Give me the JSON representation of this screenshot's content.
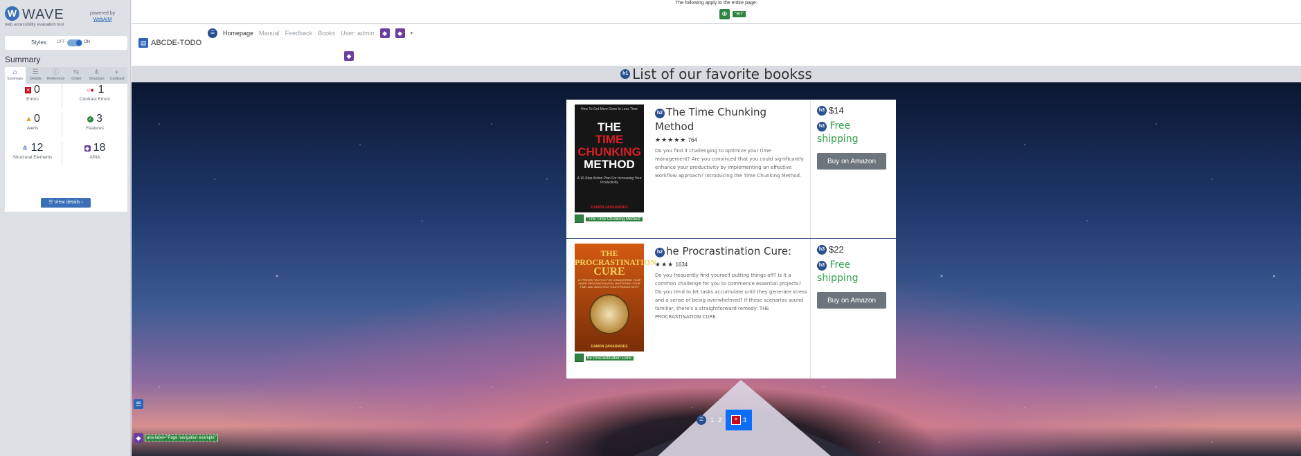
{
  "wave": {
    "logo_letter": "W",
    "title": "WAVE",
    "subtitle": "web accessibility evaluation tool",
    "powered_by": "powered by",
    "powered_link": "WebAIM",
    "styles_label": "Styles:",
    "styles_off": "OFF",
    "styles_on": "ON",
    "summary_heading": "Summary",
    "tabs": [
      {
        "label": "Summary",
        "icon": "home-icon",
        "glyph": "⌂"
      },
      {
        "label": "Details",
        "icon": "list-icon",
        "glyph": "☰"
      },
      {
        "label": "Reference",
        "icon": "info-icon",
        "glyph": "ⓘ"
      },
      {
        "label": "Order",
        "icon": "order-icon",
        "glyph": "⇆"
      },
      {
        "label": "Structure",
        "icon": "structure-icon",
        "glyph": "⋔"
      },
      {
        "label": "Contrast",
        "icon": "contrast-icon",
        "glyph": "◐"
      }
    ],
    "stats": {
      "errors": {
        "value": "0",
        "label": "Errors"
      },
      "contrast_errors": {
        "value": "1",
        "label": "Contrast Errors"
      },
      "alerts": {
        "value": "0",
        "label": "Alerts"
      },
      "features": {
        "value": "3",
        "label": "Features"
      },
      "structural": {
        "value": "12",
        "label": "Structural Elements"
      },
      "aria": {
        "value": "18",
        "label": "ARIA"
      }
    },
    "view_details": "View details ›"
  },
  "page": {
    "lang_note": "The following apply to the entire page:",
    "lang_value": "\"en\"",
    "brand": "ABCDE-TODO",
    "nav": {
      "homepage": "Homepage",
      "manual": "Manual",
      "feedback": "Feedback",
      "books": "Books",
      "user": "User: admin"
    },
    "heading": "List of our favorite bookss",
    "heading_badge": "h1",
    "books": [
      {
        "title": "The Time Chunking Method",
        "title_badge": "h2",
        "stars": "★★★★★",
        "reviews": "764",
        "description": "Do you find it challenging to optimize your time management? Are you convinced that you could significantly enhance your productivity by implementing an effective workflow approach? Introducing the Time Chunking Method.",
        "price": "$14",
        "shipping": "Free shipping",
        "price_badge": "h3",
        "button": "Buy on Amazon",
        "alt_text": "\"The Time Chunking Method\"",
        "cover_top": "How To Get More Done In Less Time",
        "cover_line1": "THE",
        "cover_line2": "TIME",
        "cover_line3": "CHUNKING",
        "cover_line4": "METHOD",
        "cover_sub": "A 10-Step Action Plan For Increasing Your Productivity",
        "cover_author": "DAMON ZAHARIADES"
      },
      {
        "title": "he Procrastination Cure:",
        "title_badge": "h2",
        "stars": "★★★",
        "reviews": "1634",
        "description": "Do you frequently find yourself putting things off? Is it a common challenge for you to commence essential projects? Do you tend to let tasks accumulate until they generate stress and a sense of being overwhelmed? If these scenarios sound familiar, there's a straightforward remedy: THE PROCRASTINATION CURE.",
        "price": "$22",
        "shipping": "Free shipping",
        "price_badge": "h3",
        "button": "Buy on Amazon",
        "alt_text": "he Procrastination Cure:",
        "cover_line1": "THE",
        "cover_line2": "PROCRASTINATION",
        "cover_line3": "CURE",
        "cover_sub": "21 PROVEN TACTICS FOR CONQUERING YOUR INNER PROCRASTINATOR, MASTERING YOUR TIME, AND BOOSTING YOUR PRODUCTIVITY",
        "cover_author": "DAMON ZAHARIADES"
      }
    ],
    "pagination": {
      "pages": [
        "1",
        "2",
        "3"
      ],
      "current": "3"
    },
    "aria_label_tag": "aria-label=\"Page navigation example\""
  },
  "colors": {
    "wave_blue": "#3b6fb7",
    "error_red": "#d0021b",
    "feature_green": "#2e8540",
    "aria_purple": "#6b3fa0",
    "pagination_active": "#0d6efd",
    "free_shipping": "#2e9e4a"
  }
}
